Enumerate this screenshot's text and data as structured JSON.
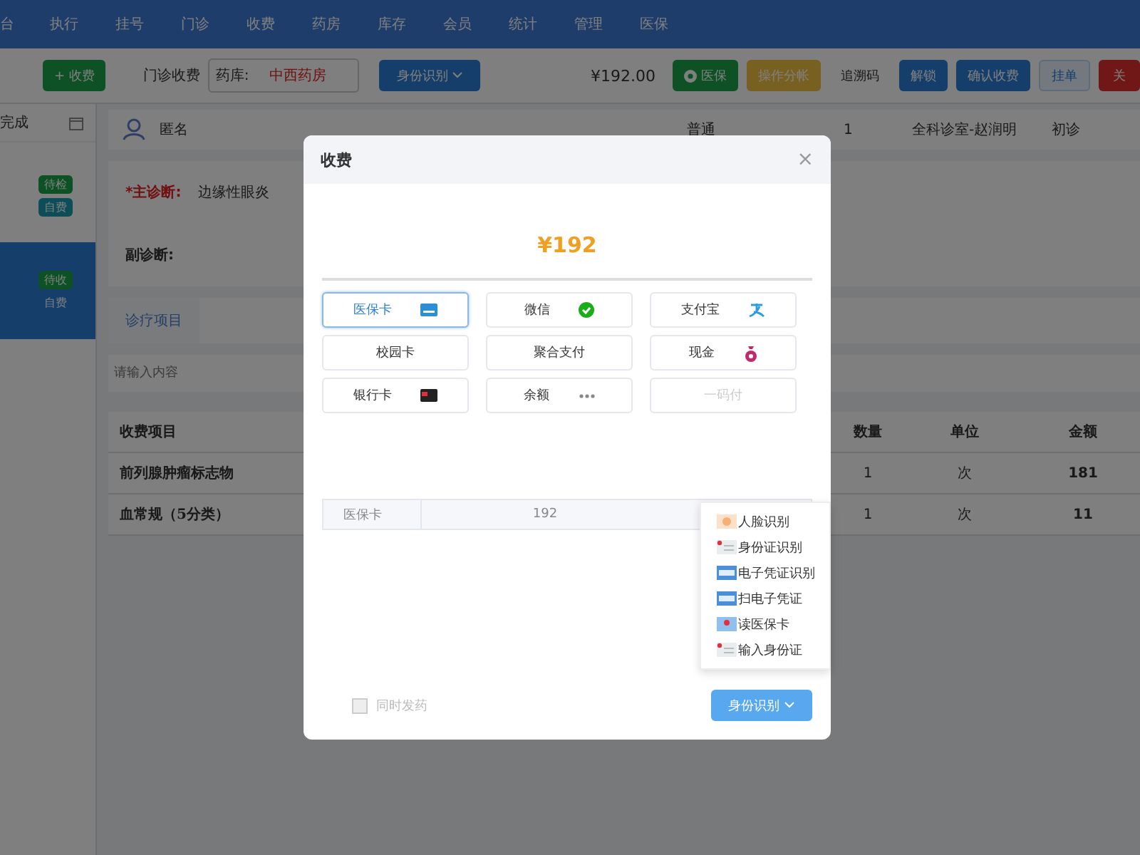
{
  "nav": {
    "items": [
      {
        "label": "台"
      },
      {
        "label": "执行"
      },
      {
        "label": "挂号"
      },
      {
        "label": "门诊"
      },
      {
        "label": "收费"
      },
      {
        "label": "药房"
      },
      {
        "label": "库存"
      },
      {
        "label": "会员"
      },
      {
        "label": "统计"
      },
      {
        "label": "管理"
      },
      {
        "label": "医保"
      }
    ]
  },
  "toolbar": {
    "add_button": "+ 收费",
    "title": "门诊收费",
    "pharmacy_label": "药库:",
    "pharmacy_value": "中西药房",
    "id_button": "身份识别",
    "total": "¥192.00",
    "insurance_button": "医保",
    "split_button": "操作分帐",
    "trace_button": "追溯码",
    "unlock_button": "解锁",
    "confirm_button": "确认收费",
    "hold_button": "挂单",
    "close_button": "关"
  },
  "sidebar": {
    "header": "完成",
    "items": [
      {
        "selected": false,
        "tags": [
          {
            "label": "待检",
            "color": "#0d5225"
          },
          {
            "label": "自费",
            "color": "#0d4d58"
          }
        ]
      },
      {
        "selected": true,
        "tags": [
          {
            "label": "待收",
            "color": "#0d5225"
          },
          {
            "label": "自费"
          }
        ]
      }
    ]
  },
  "patient": {
    "name": "匿名",
    "type": "普通",
    "visits": "1",
    "department": "全科诊室-赵润明",
    "visit_kind": "初诊"
  },
  "diagnosis": {
    "main_label": "*主诊断:",
    "main_value": "边缘性眼炎",
    "secondary_label": "副诊断:"
  },
  "tabs": [
    {
      "label": "诊疗项目"
    }
  ],
  "search": {
    "placeholder": "请输入内容"
  },
  "table": {
    "columns": [
      "收费项目",
      "数量",
      "单位",
      "金额"
    ],
    "rows": [
      [
        "前列腺肿瘤标志物",
        "1",
        "次",
        "181"
      ],
      [
        "血常规（5分类）",
        "1",
        "次",
        "11"
      ]
    ]
  },
  "dialog": {
    "title": "收费",
    "close": "×",
    "amount": "¥192",
    "methods": [
      {
        "label": "医保卡",
        "kind": "card",
        "selected": true,
        "disabled": false
      },
      {
        "label": "微信",
        "kind": "wechat",
        "selected": false,
        "disabled": false
      },
      {
        "label": "支付宝",
        "kind": "alipay",
        "selected": false,
        "disabled": false
      },
      {
        "label": "校园卡",
        "kind": "none",
        "selected": false,
        "disabled": false
      },
      {
        "label": "聚合支付",
        "kind": "none",
        "selected": false,
        "disabled": false
      },
      {
        "label": "现金",
        "kind": "cash",
        "selected": false,
        "disabled": false
      },
      {
        "label": "银行卡",
        "kind": "bank",
        "selected": false,
        "disabled": false
      },
      {
        "label": "余额",
        "kind": "dots",
        "selected": false,
        "disabled": false
      },
      {
        "label": "一码付",
        "kind": "none",
        "selected": false,
        "disabled": true
      }
    ],
    "payment_row": {
      "label": "医保卡",
      "value": "192"
    },
    "checkbox": {
      "label": "同时发药",
      "checked": false,
      "disabled": true
    },
    "id_button": "身份识别",
    "menu": [
      {
        "label": "人脸识别",
        "kind": "face"
      },
      {
        "label": "身份证识别",
        "kind": "idcard"
      },
      {
        "label": "电子凭证识别",
        "kind": "ecert"
      },
      {
        "label": "扫电子凭证",
        "kind": "ecert"
      },
      {
        "label": "读医保卡",
        "kind": "medcard"
      },
      {
        "label": "输入身份证",
        "kind": "idcard"
      }
    ]
  }
}
